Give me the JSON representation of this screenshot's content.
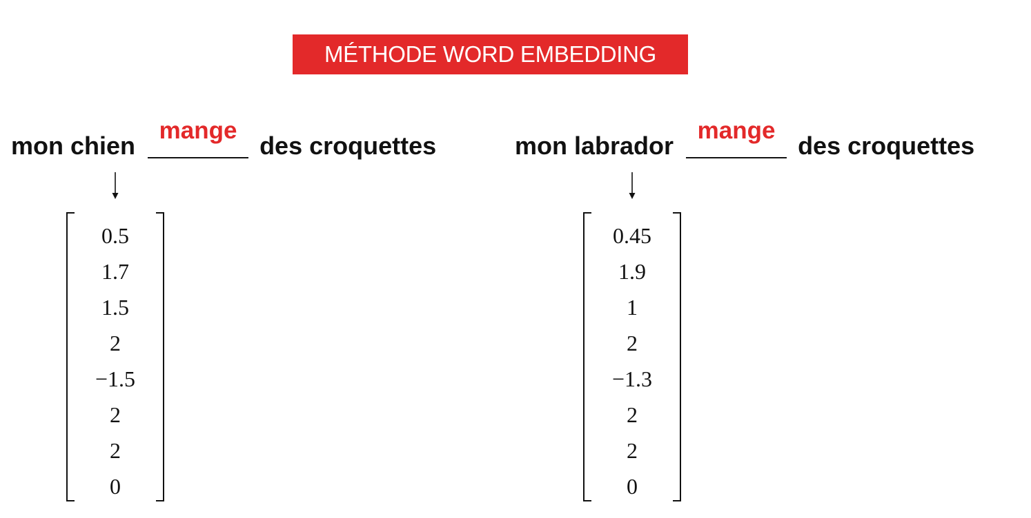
{
  "title": "MÉTHODE WORD EMBEDDING",
  "colors": {
    "accent": "#e3292a",
    "text": "#111111",
    "background": "#ffffff"
  },
  "examples": [
    {
      "before": "mon chien",
      "fill": "mange",
      "after": "des croquettes",
      "vector": [
        "0.5",
        "1.7",
        "1.5",
        "2",
        "−1.5",
        "2",
        "2",
        "0"
      ]
    },
    {
      "before": "mon labrador",
      "fill": "mange",
      "after": "des croquettes",
      "vector": [
        "0.45",
        "1.9",
        "1",
        "2",
        "−1.3",
        "2",
        "2",
        "0"
      ]
    }
  ]
}
